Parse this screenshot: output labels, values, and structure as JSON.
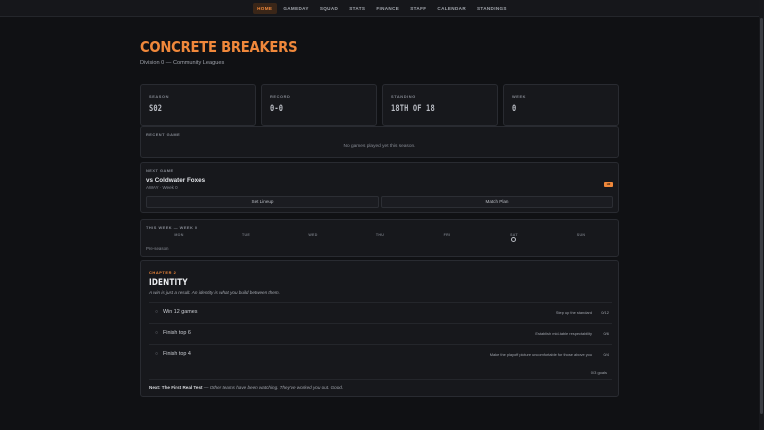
{
  "nav": {
    "items": [
      "HOME",
      "GAMEDAY",
      "SQUAD",
      "STATS",
      "FINANCE",
      "STAFF",
      "CALENDAR",
      "STANDINGS"
    ],
    "active": "HOME"
  },
  "team": {
    "name": "CONCRETE BREAKERS",
    "division": "Division 0 — Community Leagues"
  },
  "stats": [
    {
      "label": "SEASON",
      "value": "S02"
    },
    {
      "label": "RECORD",
      "value": "0-0"
    },
    {
      "label": "STANDING",
      "value": "18TH OF 18"
    },
    {
      "label": "WEEK",
      "value": "0"
    }
  ],
  "recent_game": {
    "label": "RECENT GAME",
    "empty_text": "No games played yet this season."
  },
  "next_game": {
    "label": "NEXT GAME",
    "opponent": "vs Coldwater Foxes",
    "meta": "AWAY · Week 0",
    "badge": "H2",
    "set_lineup": "Set Lineup",
    "match_plan": "Match Plan"
  },
  "this_week": {
    "label": "THIS WEEK — WEEK 0",
    "days": [
      "MON",
      "TUE",
      "WED",
      "THU",
      "FRI",
      "SAT",
      "SUN"
    ],
    "game_day": "SAT",
    "status": "Pre-season"
  },
  "chapter": {
    "kicker": "CHAPTER 2",
    "title": "IDENTITY",
    "quote": "A win is just a result. An identity is what you build between them.",
    "goals": [
      {
        "icon": "○",
        "name": "Win 12 games",
        "hint": "Step up the standard",
        "count": "0/12"
      },
      {
        "icon": "○",
        "name": "Finish top 6",
        "hint": "Establish mid-table respectability",
        "count": "0/6"
      },
      {
        "icon": "○",
        "name": "Finish top 4",
        "hint": "Make the playoff picture uncomfortable for those above you",
        "count": "0/4"
      }
    ],
    "goals_total": "0/3 goals",
    "next_label": "Next:",
    "next_title": "The First Real Test",
    "next_text": "Other teams have been watching. They've worked you out. Good."
  },
  "colors": {
    "accent": "#f0883b",
    "background": "#101114",
    "card": "#17181c"
  }
}
